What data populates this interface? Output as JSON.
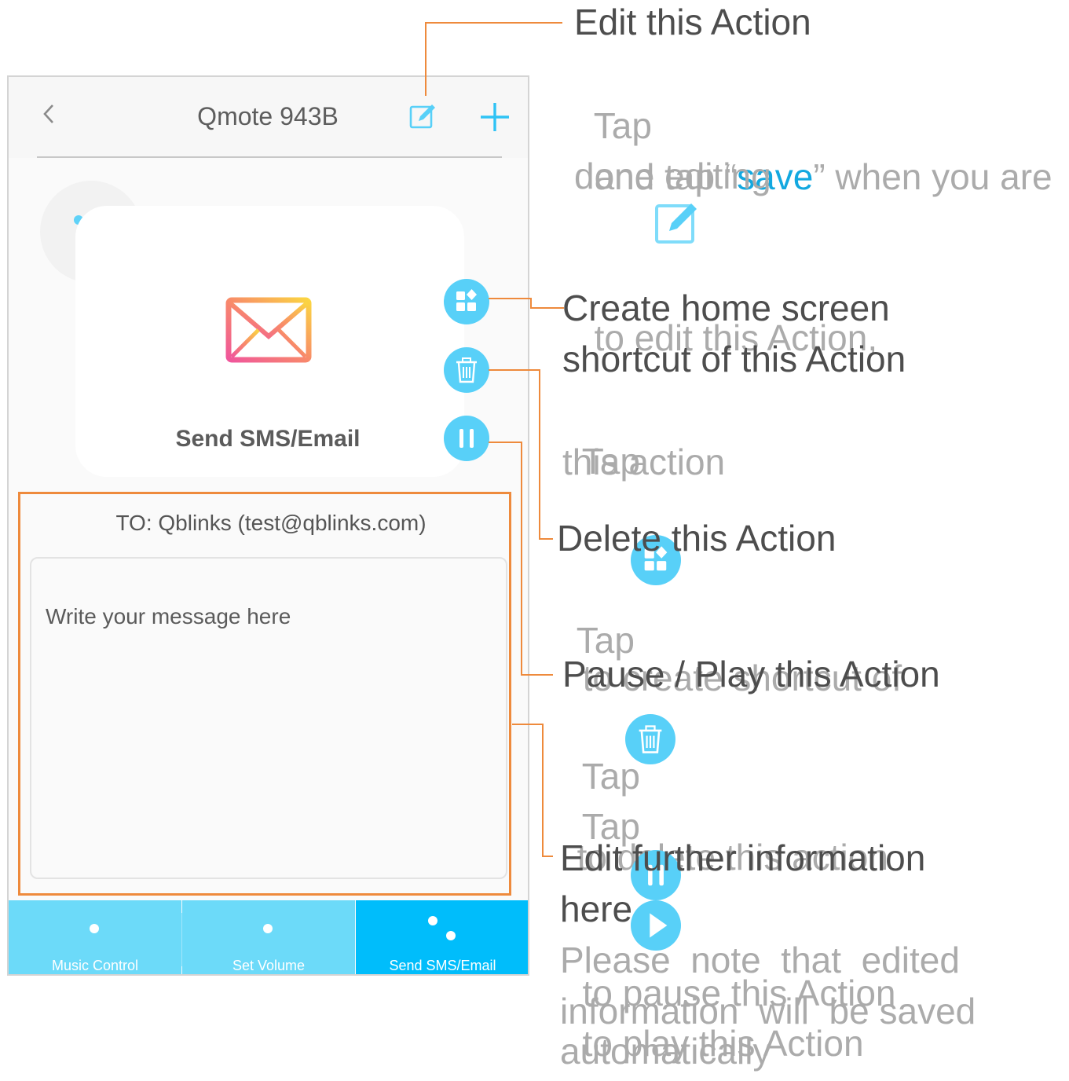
{
  "app": {
    "title": "Qmote 943B",
    "back_icon": "chevron-left-icon",
    "edit_icon": "edit-icon",
    "add_icon": "plus-icon"
  },
  "action_card": {
    "icon": "envelope-icon",
    "label": "Send SMS/Email"
  },
  "fab_buttons": [
    "shortcut-icon",
    "trash-icon",
    "pause-icon"
  ],
  "message": {
    "to": "TO: Qblinks (test@qblinks.com)",
    "placeholder": "Write your message here"
  },
  "tabs": [
    {
      "label": "Music Control",
      "active": false
    },
    {
      "label": "Set Volume",
      "active": false
    },
    {
      "label": "Send SMS/Email",
      "active": true
    }
  ],
  "annotations": {
    "edit": {
      "title": "Edit this Action",
      "desc_line1_a": "Tap",
      "desc_line1_b": "to edit this Action,",
      "desc_line2_a": "and tap “",
      "desc_line2_hl": "save",
      "desc_line2_b": "” when you are",
      "desc_line3": "done editing"
    },
    "shortcut": {
      "title_line1": "Create home screen",
      "title_line2": "shortcut of this Action",
      "desc_line1_a": "Tap",
      "desc_line1_b": "to create shortcut of",
      "desc_line2": "this action"
    },
    "delete": {
      "title": "Delete this Action",
      "desc_a": "Tap",
      "desc_b": "to delete this action"
    },
    "pause": {
      "title": "Pause / Play this Action",
      "desc_line1_a": "Tap",
      "desc_line1_b": "to pause this Action",
      "desc_line2_a": "Tap",
      "desc_line2_b": "to play this Action"
    },
    "further": {
      "title_line1": "Edit further information",
      "title_line2": "here",
      "desc_line1": "Please  note  that  edited",
      "desc_line2": "information  will  be saved",
      "desc_line3": "automatically"
    }
  },
  "colors": {
    "accent": "#58d0f8",
    "active_tab": "#00bdfb",
    "tab": "#6cdaf9",
    "callout": "#ee8a3c",
    "highlight": "#12a8e0"
  }
}
